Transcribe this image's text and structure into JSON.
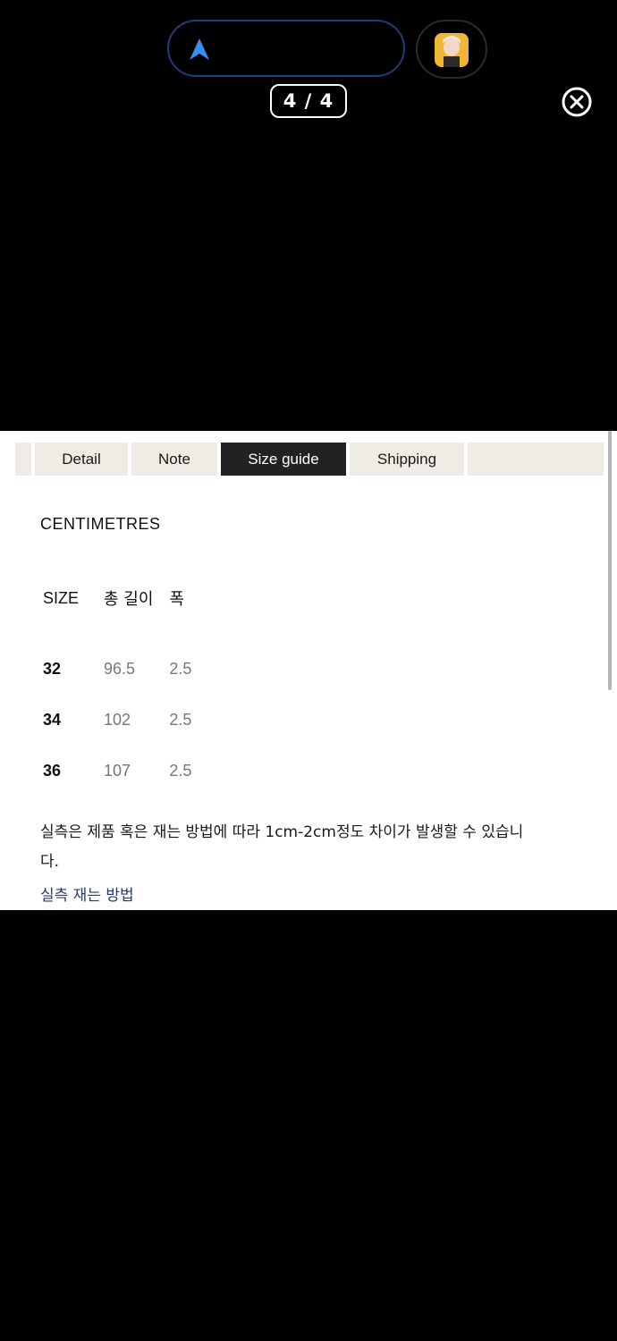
{
  "overlay": {
    "counter": "4 / 4"
  },
  "tabs": [
    {
      "label": "Detail"
    },
    {
      "label": "Note"
    },
    {
      "label": "Size guide"
    },
    {
      "label": "Shipping"
    }
  ],
  "size_guide": {
    "unit": "CENTIMETRES",
    "columns": [
      "SIZE",
      "총 길이",
      "폭"
    ],
    "rows": [
      {
        "size": "32",
        "length": "96.5",
        "width": "2.5"
      },
      {
        "size": "34",
        "length": "102",
        "width": "2.5"
      },
      {
        "size": "36",
        "length": "107",
        "width": "2.5"
      }
    ],
    "note": "실측은 제품 혹은 재는 방법에 따라 1cm-2cm정도 차이가 발생할 수 있습니다.",
    "link": "실측 재는 방법"
  },
  "colors": {
    "active_tab": "#222222",
    "tab_bg": "#efebe5",
    "link": "#2b3a6b",
    "nav_arrow": "#3d8bf5"
  },
  "icons": [
    "navigation-arrow-icon",
    "avatar",
    "close-icon"
  ]
}
